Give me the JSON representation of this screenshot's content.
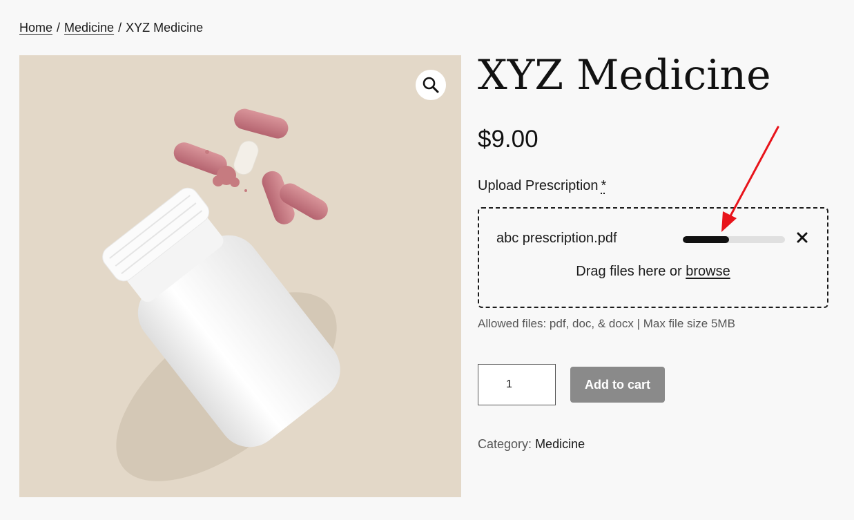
{
  "breadcrumb": {
    "home": "Home",
    "separator": "/",
    "category": "Medicine",
    "current": "XYZ Medicine"
  },
  "product": {
    "title": "XYZ Medicine",
    "price": "$9.00",
    "category_label": "Category:",
    "category_value": "Medicine"
  },
  "upload": {
    "label": "Upload Prescription",
    "required_mark": "*",
    "file_name": "abc prescription.pdf",
    "progress": 0.45,
    "drag_text": "Drag files here or",
    "browse_label": "browse",
    "allowed_text": "Allowed files: pdf, doc, & docx | Max file size 5MB"
  },
  "cart": {
    "quantity": "1",
    "add_button": "Add to cart"
  },
  "colors": {
    "page_bg": "#f8f8f8",
    "image_bg": "#e3d8c8",
    "button_bg": "#8a8a8a",
    "annotation": "#e8141b"
  },
  "icons": {
    "zoom": "magnifier-icon",
    "remove": "close-icon"
  }
}
